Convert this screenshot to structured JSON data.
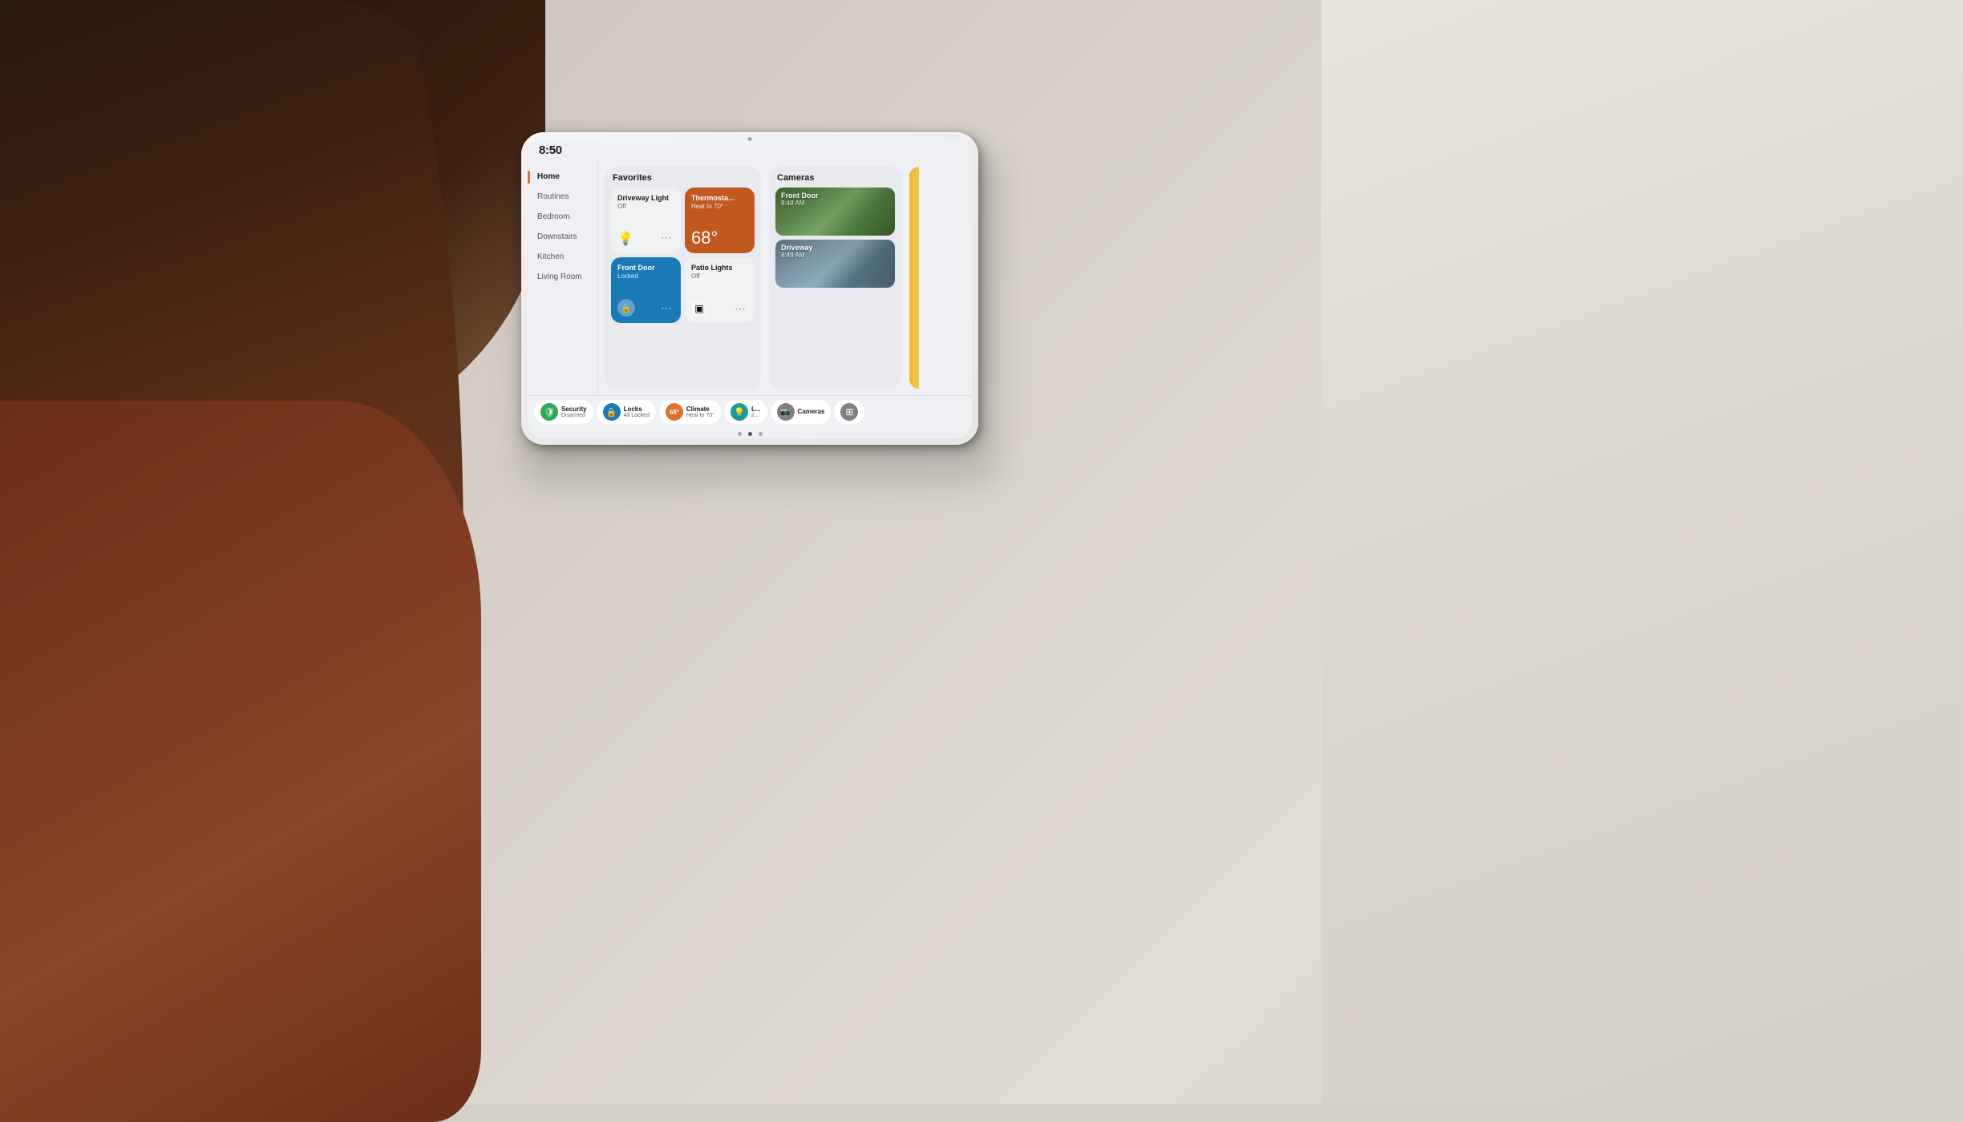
{
  "scene": {
    "background_color": "#d4cfc8"
  },
  "device": {
    "time": "8:50",
    "camera_dot": true
  },
  "sidebar": {
    "items": [
      {
        "label": "Home",
        "active": true
      },
      {
        "label": "Routines",
        "active": false
      },
      {
        "label": "Bedroom",
        "active": false
      },
      {
        "label": "Downstairs",
        "active": false
      },
      {
        "label": "Kitchen",
        "active": false
      },
      {
        "label": "Living Room",
        "active": false
      }
    ]
  },
  "favorites": {
    "title": "Favorites",
    "tiles": [
      {
        "id": "driveway-light",
        "name": "Driveway Light",
        "status": "Off",
        "type": "light-off",
        "icon": "💡"
      },
      {
        "id": "thermostat",
        "name": "Thermosta...",
        "status": "Heat to 70°",
        "type": "thermostat",
        "temp": "68°"
      },
      {
        "id": "front-door",
        "name": "Front Door",
        "status": "Locked",
        "type": "front-door",
        "icon": "🔒"
      },
      {
        "id": "patio-lights",
        "name": "Patio Lights",
        "status": "Off",
        "type": "patio-lights",
        "icon": "▣"
      }
    ]
  },
  "cameras": {
    "title": "Cameras",
    "items": [
      {
        "id": "front-door-cam",
        "name": "Front Door",
        "time": "8:48 AM"
      },
      {
        "id": "driveway-cam",
        "name": "Driveway",
        "time": "8:49 AM"
      }
    ]
  },
  "bottom_bar": {
    "pills": [
      {
        "id": "security",
        "icon": "🛡",
        "icon_class": "green",
        "label": "Security",
        "sub": "Disarmed"
      },
      {
        "id": "locks",
        "icon": "🔒",
        "icon_class": "blue",
        "label": "Locks",
        "sub": "All Locked"
      },
      {
        "id": "climate",
        "icon": "68°",
        "icon_class": "orange",
        "label": "Climate",
        "sub": "Heat to 70°"
      },
      {
        "id": "lights",
        "icon": "💡",
        "icon_class": "teal",
        "label": "L...",
        "sub": "2..."
      },
      {
        "id": "cameras",
        "icon": "📷",
        "icon_class": "gray",
        "label": "Cameras",
        "sub": ""
      },
      {
        "id": "grid",
        "icon": "⊞",
        "icon_class": "gray",
        "label": "",
        "sub": ""
      }
    ]
  },
  "page_dots": [
    {
      "active": false
    },
    {
      "active": true
    },
    {
      "active": false
    }
  ]
}
